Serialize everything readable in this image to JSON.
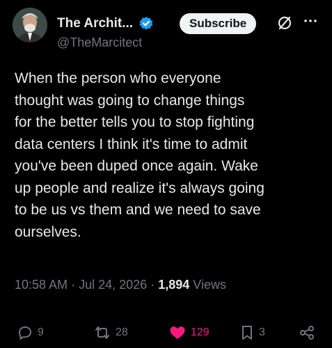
{
  "author": {
    "display_name": "The Archit...",
    "handle": "@TheMarcitect",
    "verified": true,
    "verified_color": "#1d9bf0"
  },
  "header_actions": {
    "subscribe_label": "Subscribe",
    "grok_icon": "grok-icon",
    "more_icon": "more-icon"
  },
  "tweet": {
    "lines": [
      "When the person who everyone",
      "thought was going to change things",
      "for the better tells you to stop fighting",
      "data centers I think it's time to admit",
      "you've been duped once again. Wake",
      "up people and realize it's always going",
      "to be us vs them and we need to save",
      "ourselves."
    ]
  },
  "meta": {
    "time": "10:58 AM",
    "sep1": "·",
    "date": "Jul 24, 2026",
    "sep2": "·",
    "views_count": "1,894",
    "views_label": "Views"
  },
  "actions": {
    "replies": "9",
    "reposts": "28",
    "likes": "129",
    "bookmarks": "3",
    "like_color": "#f91880"
  },
  "colors": {
    "background": "#000000",
    "text": "#e7e9ea",
    "muted": "#71767b"
  }
}
